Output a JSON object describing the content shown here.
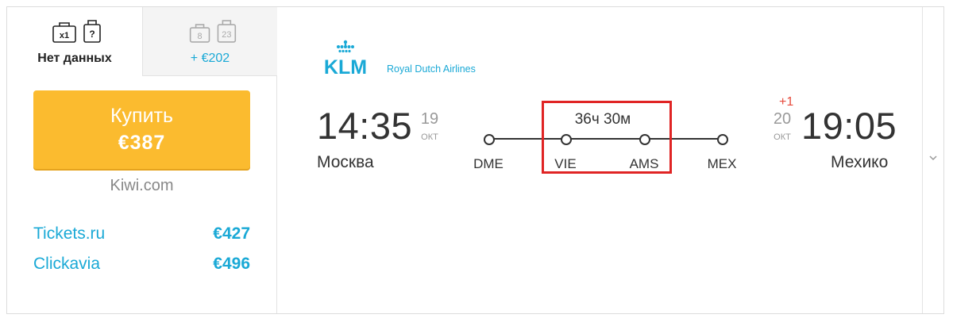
{
  "baggage": {
    "selected": {
      "label": "Нет данных",
      "icons": [
        {
          "name": "suitcase-x1-icon",
          "text": "x1"
        },
        {
          "name": "luggage-unknown-icon",
          "text": "?"
        }
      ]
    },
    "option": {
      "label": "+ €202",
      "icons": [
        {
          "name": "suitcase-8kg-icon",
          "text": "8"
        },
        {
          "name": "luggage-23kg-icon",
          "text": "23"
        }
      ]
    }
  },
  "purchase": {
    "buy_label": "Купить",
    "buy_price": "€387",
    "seller": "Kiwi.com",
    "agencies": [
      {
        "name": "Tickets.ru",
        "price": "€427"
      },
      {
        "name": "Clickavia",
        "price": "€496"
      }
    ]
  },
  "airline": {
    "logo_text": "KLM",
    "name": "Royal Dutch Airlines"
  },
  "flight": {
    "depart": {
      "time": "14:35",
      "day": "19",
      "month": "ОКТ",
      "city": "Москва"
    },
    "arrive": {
      "time": "19:05",
      "day": "20",
      "month": "ОКТ",
      "city": "Мехико",
      "day_offset": "+1"
    },
    "duration": "36ч 30м",
    "airports": [
      "DME",
      "VIE",
      "AMS",
      "MEX"
    ]
  },
  "colors": {
    "accent": "#1aa9d6",
    "buy_button": "#fbbb2f",
    "highlight": "#e02424",
    "day_offset": "#e64a3c"
  }
}
